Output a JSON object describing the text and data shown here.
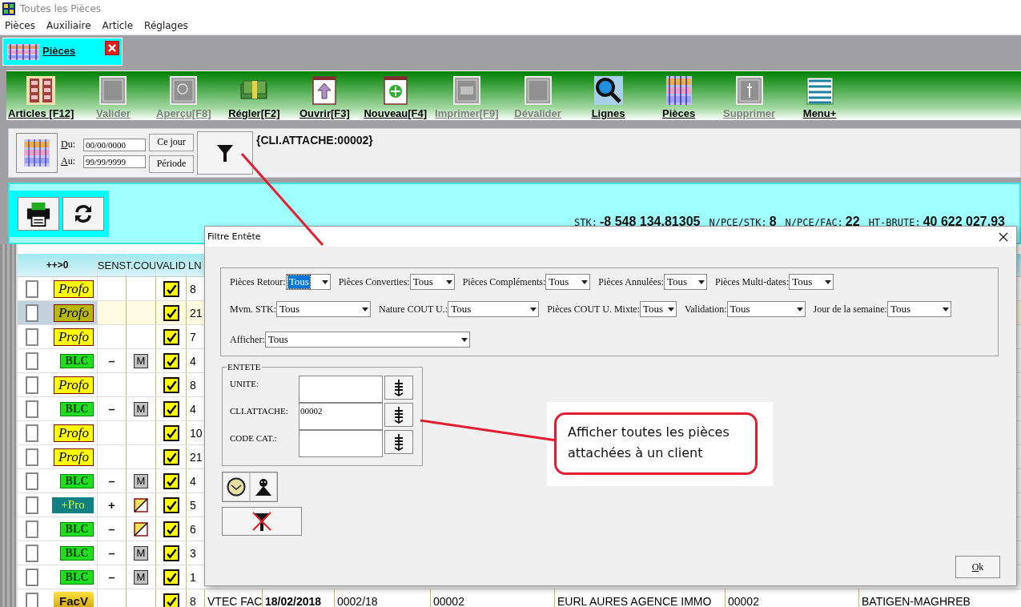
{
  "window": {
    "title": "Toutes les Pièces"
  },
  "menu": [
    "Pièces",
    "Auxiliaire",
    "Article",
    "Réglages"
  ],
  "tab": {
    "label": "Pièces"
  },
  "toolbar": [
    {
      "label": "Articles [F12]",
      "disabled": false
    },
    {
      "label": "Valider",
      "disabled": true
    },
    {
      "label": "Aperçu[F8]",
      "disabled": true
    },
    {
      "label": "Régler[F2]",
      "disabled": false
    },
    {
      "label": "Ouvrir[F3]",
      "disabled": false
    },
    {
      "label": "Nouveau[F4]",
      "disabled": false
    },
    {
      "label": "Imprimer[F9]",
      "disabled": true
    },
    {
      "label": "Dévalider",
      "disabled": true
    },
    {
      "label": "Lignes",
      "disabled": false
    },
    {
      "label": "Pièces",
      "disabled": false
    },
    {
      "label": "Supprimer",
      "disabled": true
    },
    {
      "label": "Menu+",
      "disabled": false
    }
  ],
  "filter_bar": {
    "from_label": "Du:",
    "from_value": "00/00/0000",
    "to_label": "Au:",
    "to_value": "99/99/9999",
    "buttons": [
      "Ce jour",
      "Période"
    ],
    "filter_text": "{CLI.ATTACHE:00002}"
  },
  "stats": [
    {
      "label": "STK:",
      "value": "-8 548 134,81305"
    },
    {
      "label": "N/PCE/STK:",
      "value": "8"
    },
    {
      "label": "N/PCE/FAC:",
      "value": "22"
    },
    {
      "label": "HT-BRUTE:",
      "value": "40 622 027,93"
    }
  ],
  "table": {
    "columns": [
      "++>0",
      "SENS",
      "T.COU",
      "VALID",
      "LN"
    ],
    "rows": [
      {
        "checked": false,
        "selected": false,
        "type": {
          "kind": "profo",
          "text": "Profo"
        },
        "valid": true,
        "lns": "8"
      },
      {
        "checked": false,
        "selected": true,
        "type": {
          "kind": "profo",
          "text": "Profo"
        },
        "valid": true,
        "lns": "21"
      },
      {
        "checked": false,
        "selected": false,
        "type": {
          "kind": "profo",
          "text": "Profo"
        },
        "valid": true,
        "lns": "7"
      },
      {
        "checked": false,
        "selected": false,
        "type": {
          "kind": "blc",
          "text": "BLC"
        },
        "sens": "–",
        "tcou": {
          "kind": "label",
          "text": "M"
        },
        "valid": true,
        "lns": "4"
      },
      {
        "checked": false,
        "selected": false,
        "type": {
          "kind": "profo",
          "text": "Profo"
        },
        "valid": true,
        "lns": "8"
      },
      {
        "checked": false,
        "selected": false,
        "type": {
          "kind": "blc",
          "text": "BLC"
        },
        "sens": "–",
        "tcou": {
          "kind": "label",
          "text": "M"
        },
        "valid": true,
        "lns": "4"
      },
      {
        "checked": false,
        "selected": false,
        "type": {
          "kind": "profo",
          "text": "Profo"
        },
        "valid": true,
        "lns": "10"
      },
      {
        "checked": false,
        "selected": false,
        "type": {
          "kind": "profo",
          "text": "Profo"
        },
        "valid": true,
        "lns": "21"
      },
      {
        "checked": false,
        "selected": false,
        "type": {
          "kind": "blc",
          "text": "BLC"
        },
        "sens": "–",
        "tcou": {
          "kind": "label",
          "text": "M"
        },
        "valid": true,
        "lns": "4"
      },
      {
        "checked": false,
        "selected": false,
        "type": {
          "kind": "pro",
          "text": "+Pro"
        },
        "sens": "+",
        "tcou": {
          "kind": "half"
        },
        "valid": true,
        "lns": "5"
      },
      {
        "checked": false,
        "selected": false,
        "type": {
          "kind": "blc",
          "text": "BLC"
        },
        "sens": "–",
        "tcou": {
          "kind": "half"
        },
        "valid": true,
        "lns": "6"
      },
      {
        "checked": false,
        "selected": false,
        "type": {
          "kind": "blc",
          "text": "BLC"
        },
        "sens": "–",
        "tcou": {
          "kind": "label",
          "text": "M"
        },
        "valid": true,
        "lns": "3"
      },
      {
        "checked": false,
        "selected": false,
        "type": {
          "kind": "blc",
          "text": "BLC"
        },
        "sens": "–",
        "tcou": {
          "kind": "label",
          "text": "M"
        },
        "valid": true,
        "lns": "1"
      },
      {
        "checked": false,
        "selected": false,
        "type": {
          "kind": "facv",
          "text": "FacV"
        },
        "valid": true,
        "lns": "8",
        "cells": [
          {
            "text": "VTEC FAC",
            "bold": false
          },
          {
            "text": "18/02/2018",
            "bold": true
          },
          {
            "text": "0002/18",
            "bold": false
          },
          {
            "text": "00002",
            "bold": false
          },
          {
            "text": "EURL AURES AGENCE IMMO",
            "bold": false
          },
          {
            "text": "00002",
            "bold": false
          },
          {
            "text": "BATIGEN-MAGHREB",
            "bold": false
          }
        ]
      }
    ]
  },
  "dialog": {
    "title": "Filtre Entête",
    "filters": [
      [
        {
          "label": "Pièces Retour:",
          "value": "Tous",
          "focused": true
        },
        {
          "label": "Pièces Converties:",
          "value": "Tous",
          "focused": false
        },
        {
          "label": "Pièces Compléments:",
          "value": "Tous",
          "focused": false
        },
        {
          "label": "Pièces Annulées:",
          "value": "Tous",
          "focused": false
        },
        {
          "label": "Pièces Multi-dates:",
          "value": "Tous",
          "focused": false
        }
      ],
      [
        {
          "label": "Mvm. STK:",
          "value": "Tous",
          "focused": false
        },
        {
          "label": "Nature COUT U.:",
          "value": "Tous",
          "focused": false
        },
        {
          "label": "Pièces COUT U. Mixte:",
          "value": "Tous",
          "focused": false
        },
        {
          "label": "Validation:",
          "value": "Tous",
          "focused": false
        },
        {
          "label": "Jour de la semaine:",
          "value": "Tous",
          "focused": false
        }
      ],
      [
        {
          "label": "Afficher:",
          "value": "Tous",
          "focused": false
        }
      ]
    ],
    "entete": {
      "legend": "ENTETE",
      "fields": [
        {
          "label": "UNITE:"
        },
        {
          "label": "CLI.ATTACHE:",
          "value": "00002"
        },
        {
          "label": "CODE CAT.:"
        }
      ]
    },
    "ok": "Ok"
  },
  "callout": {
    "text": "Afficher toutes les pièces attachées à un client"
  }
}
